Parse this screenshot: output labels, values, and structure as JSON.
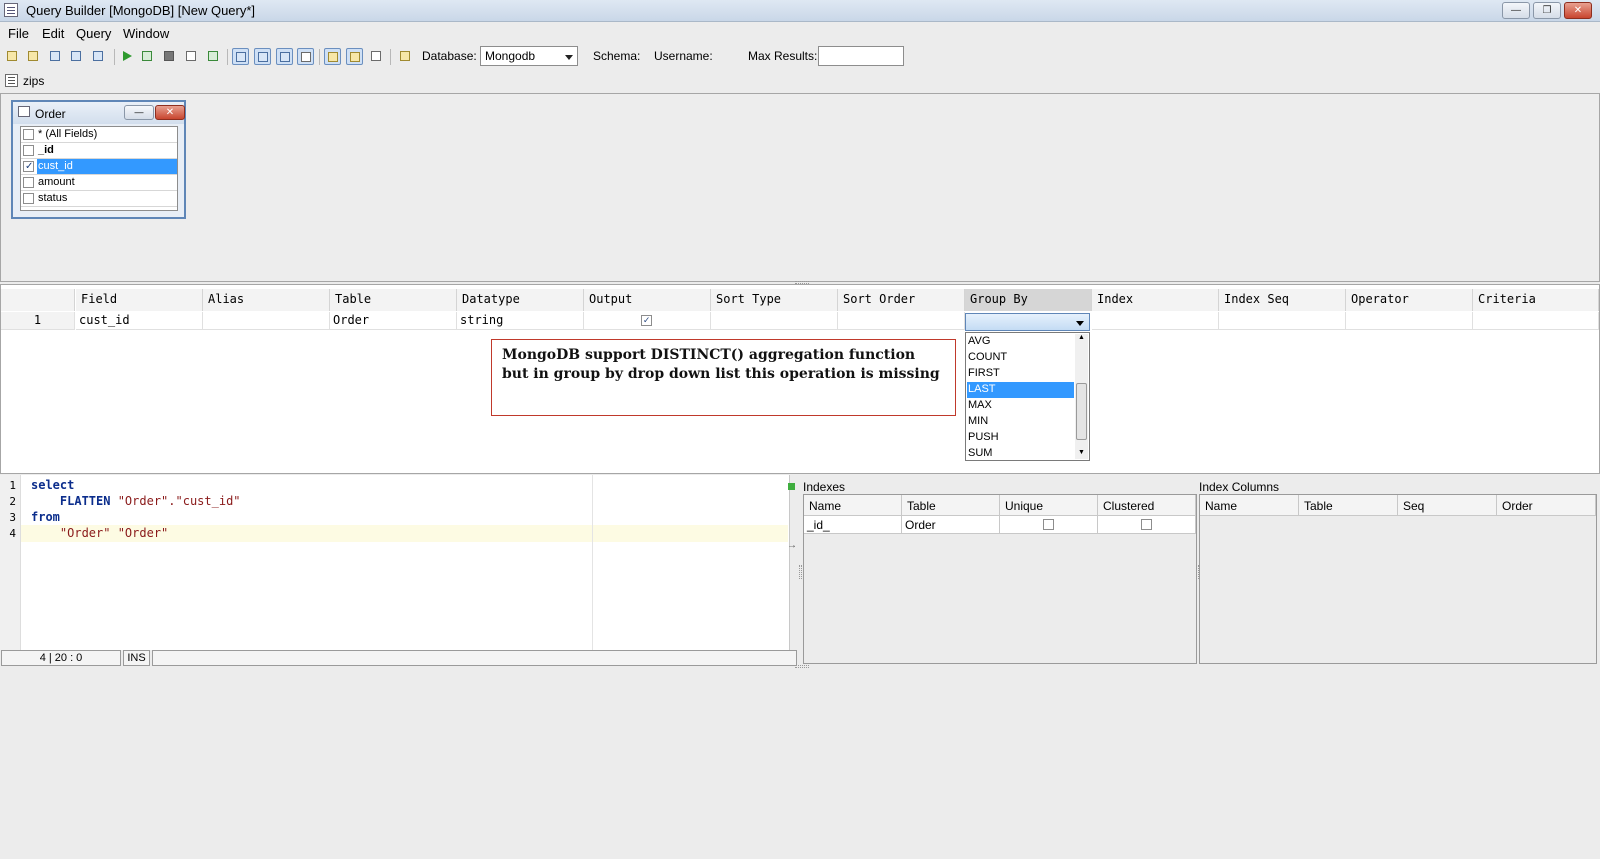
{
  "window": {
    "title": "Query Builder [MongoDB] [New Query*]",
    "min_glyph": "—",
    "restore_glyph": "❐",
    "close_glyph": "✕"
  },
  "menu": [
    "File",
    "Edit",
    "Query",
    "Window"
  ],
  "toolbar": {
    "database_label": "Database:",
    "database_value": "Mongodb",
    "schema_label": "Schema:",
    "username_label": "Username:",
    "maxresults_label": "Max Results:",
    "maxresults_value": ""
  },
  "tab": {
    "label": "zips"
  },
  "table_window": {
    "title": "Order",
    "min_glyph": "—",
    "close_glyph": "✕",
    "fields": [
      {
        "name": "* (All Fields)",
        "checked": false,
        "bold": false
      },
      {
        "name": "_id",
        "checked": false,
        "bold": true
      },
      {
        "name": "cust_id",
        "checked": true,
        "bold": false
      },
      {
        "name": "amount",
        "checked": false,
        "bold": false
      },
      {
        "name": "status",
        "checked": false,
        "bold": false
      }
    ]
  },
  "grid": {
    "headers": [
      "Field",
      "Alias",
      "Table",
      "Datatype",
      "Output",
      "Sort Type",
      "Sort Order",
      "Group By",
      "Index",
      "Index Seq",
      "Operator",
      "Criteria"
    ],
    "rows": [
      {
        "num": "1",
        "field": "cust_id",
        "alias": "",
        "table": "Order",
        "datatype": "string",
        "output": true
      }
    ],
    "group_by_options": [
      "AVG",
      "COUNT",
      "FIRST",
      "LAST",
      "MAX",
      "MIN",
      "PUSH",
      "SUM"
    ],
    "group_by_highlighted": "LAST"
  },
  "annotation": "MongoDB support DISTINCT() aggregation function but in group by drop down list this operation is missing",
  "editor": {
    "lines": [
      {
        "num": "1",
        "parts": [
          {
            "t": "select",
            "c": "kw"
          }
        ]
      },
      {
        "num": "2",
        "parts": [
          {
            "t": "    ",
            "c": ""
          },
          {
            "t": "FLATTEN",
            "c": "kw"
          },
          {
            "t": " \"Order\".\"cust_id\"",
            "c": "str"
          }
        ]
      },
      {
        "num": "3",
        "parts": [
          {
            "t": "from",
            "c": "kw"
          }
        ]
      },
      {
        "num": "4",
        "parts": [
          {
            "t": "    \"Order\" \"Order\"",
            "c": "str"
          }
        ]
      }
    ],
    "cursor": "4 | 20 : 0",
    "mode": "INS"
  },
  "indexes": {
    "title": "Indexes",
    "headers": [
      "Name",
      "Table",
      "Unique",
      "Clustered"
    ],
    "rows": [
      {
        "name": "_id_",
        "table": "Order",
        "unique": false,
        "clustered": false
      }
    ]
  },
  "index_columns": {
    "title": "Index Columns",
    "headers": [
      "Name",
      "Table",
      "Seq",
      "Order"
    ]
  }
}
